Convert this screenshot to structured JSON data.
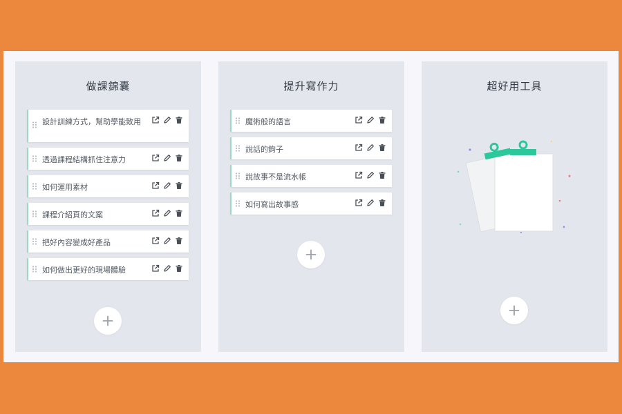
{
  "columns": [
    {
      "title": "做課錦囊",
      "cards": [
        {
          "label": "設計訓練方式，幫助學能致用"
        },
        {
          "label": "透過課程結構抓住注意力"
        },
        {
          "label": "如何運用素材"
        },
        {
          "label": "課程介紹頁的文案"
        },
        {
          "label": "把好內容變成好產品"
        },
        {
          "label": "如何做出更好的現場體驗"
        }
      ]
    },
    {
      "title": "提升寫作力",
      "cards": [
        {
          "label": "魔術般的語言"
        },
        {
          "label": "說話的鉤子"
        },
        {
          "label": "說故事不是流水帳"
        },
        {
          "label": "如何寫出故事感"
        }
      ]
    },
    {
      "title": "超好用工具",
      "cards": []
    }
  ],
  "icons": {
    "open": "external-link-icon",
    "edit": "pencil-icon",
    "delete": "trash-icon",
    "drag": "drag-handle-icon",
    "add": "plus-icon"
  },
  "colors": {
    "background": "#ec883e",
    "column": "#e3e7ed",
    "card_accent": "#9fd8c4",
    "clip": "#2cc79a",
    "icon": "#4a4f57"
  }
}
